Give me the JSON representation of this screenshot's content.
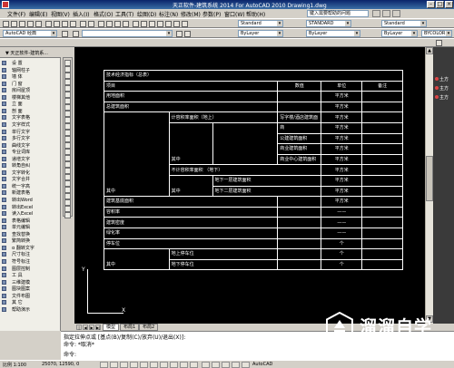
{
  "window": {
    "title": "天正软件-建筑系统 2014  For AutoCAD 2010      Drawing1.dwg"
  },
  "menu": {
    "items": [
      "文件(F)",
      "编辑(E)",
      "视图(V)",
      "插入(I)",
      "格式(O)",
      "工具(T)",
      "绘图(D)",
      "标注(N)",
      "修改(M)",
      "参数(P)",
      "窗口(W)",
      "帮助(H)"
    ],
    "help_placeholder": "键入需要帮助的问题"
  },
  "toolbars": {
    "workspace": "AutoCAD 经典",
    "text_style": "Standard",
    "dim_style": "STANDARD",
    "table_style": "Standard",
    "layer_color": "ByLayer",
    "linetype": "ByLayer",
    "lineweight": "ByLayer",
    "plotstyle": "BYCOLOR"
  },
  "left_panel": {
    "header": "▼ 天正软件-建筑系...",
    "items": [
      "设    置",
      "轴网柱子",
      "墙    体",
      "门    窗",
      "房间屋顶",
      "楼梯其他",
      "立    面",
      "剖    面",
      "文字表格",
      "文字样式",
      "单行文字",
      "多行文字",
      "曲线文字",
      "专业词库",
      "递增文字",
      "转角自纠",
      "文字转化",
      "文字合并",
      "统一字高",
      "新建表格",
      "转出Word",
      "转出Excel",
      "读入Excel",
      "表格编辑",
      "单元编辑",
      "查找替换",
      "繁简转换",
      "α 翻转文字",
      "尺寸标注",
      "符号标注",
      "图层控制",
      "工    具",
      "三维建模",
      "图块图案",
      "文件布图",
      "其    它",
      "帮助演示"
    ]
  },
  "table": {
    "title": "技术经济指标（总表）",
    "header": {
      "item": "项目",
      "value": "数值",
      "unit": "单位",
      "remark": "备注"
    },
    "rows": {
      "r1_label": "用地面积",
      "r1_unit": "平方米",
      "r2_label": "总建筑面积",
      "r2_unit": "平方米",
      "r3_sub": "计容积率面积（地上）",
      "r3_item": "写字楼/酒店建筑面",
      "r4_item": "商",
      "r4_unit": "平方米",
      "r5_item": "公建建筑面积",
      "r5_unit": "平方米",
      "r6_item": "商业建筑面积",
      "r6_unit": "平方米",
      "r7_sub": "其中",
      "r7_item": "商业中心建筑面积",
      "r7_unit": "平方米",
      "r8_sub": "不计容积率面积  （地下）",
      "r8_unit": "平方米",
      "r9_item": "地下一层建筑面积",
      "r9_unit": "平方米",
      "r10_main": "其中",
      "r10_sub": "其中",
      "r10_item": "地下二层建筑面积",
      "r10_unit": "平方米",
      "r11_label": "建筑基底面积",
      "r11_unit": "平方米",
      "r12_label": "容积率",
      "r12_unit": "——",
      "r13_label": "建筑密度",
      "r13_unit": "——",
      "r14_label": "绿化率",
      "r14_unit": "——",
      "r15_label": "停车位",
      "r15_unit": "个",
      "r16_item": "地上停车位",
      "r16_unit": "个",
      "r17_main": "其中",
      "r17_item": "地下停车位",
      "r17_unit": "个",
      "r3_unit": "平方米"
    }
  },
  "ucs": {
    "y": "Y",
    "x": "X"
  },
  "right_strip": {
    "items": [
      "土方",
      "主方",
      "主方"
    ]
  },
  "tabs": {
    "model": "模型",
    "layout1": "布局1",
    "layout2": "布局2"
  },
  "command": {
    "line1": "指定拉伸点或 [基点(B)/复制(C)/放弃(U)/退出(X)]:",
    "line2": "命令: *取消*",
    "line3": "命令:"
  },
  "status": {
    "scale": "比例 1:100",
    "coords": "25070,  12590,  0",
    "app": "AutoCAD"
  },
  "watermark": {
    "brand": "溜溜自学",
    "url": "ZIXUE.3D66.COM"
  }
}
